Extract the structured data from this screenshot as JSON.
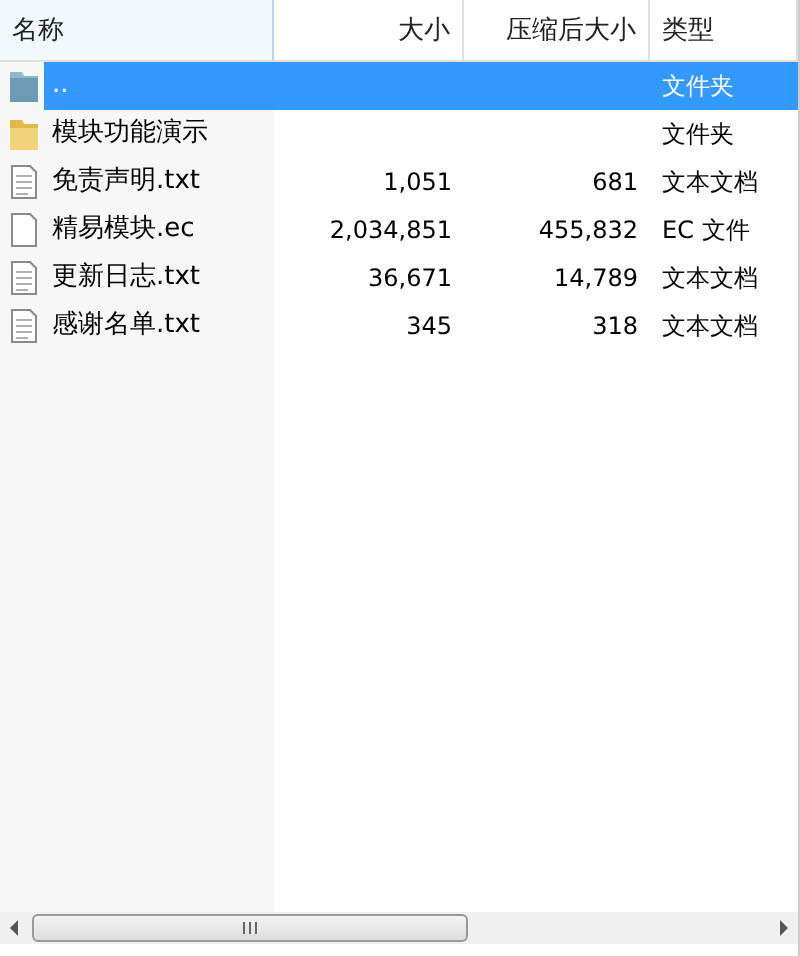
{
  "columns": [
    "名称",
    "大小",
    "压缩后大小",
    "类型"
  ],
  "rows": [
    {
      "kind": "parent",
      "name": "..",
      "size": "",
      "packed": "",
      "type": "文件夹",
      "selected": true
    },
    {
      "kind": "folder",
      "name": "模块功能演示",
      "size": "",
      "packed": "",
      "type": "文件夹",
      "selected": false
    },
    {
      "kind": "text",
      "name": "免责声明.txt",
      "size": "1,051",
      "packed": "681",
      "type": "文本文档",
      "selected": false
    },
    {
      "kind": "file",
      "name": "精易模块.ec",
      "size": "2,034,851",
      "packed": "455,832",
      "type": "EC 文件",
      "selected": false
    },
    {
      "kind": "text",
      "name": "更新日志.txt",
      "size": "36,671",
      "packed": "14,789",
      "type": "文本文档",
      "selected": false
    },
    {
      "kind": "text",
      "name": "感谢名单.txt",
      "size": "345",
      "packed": "318",
      "type": "文本文档",
      "selected": false
    }
  ]
}
